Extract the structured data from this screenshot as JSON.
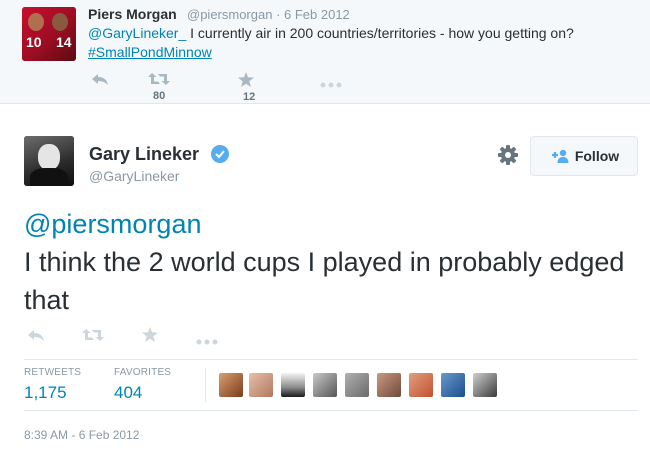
{
  "parent_tweet": {
    "author_name": "Piers Morgan",
    "meta": "@piersmorgan · 6 Feb 2012",
    "mention": "@GaryLineker_",
    "text": " I currently air in 200 countries/territories - how you getting on?",
    "hashtag": "#SmallPondMinnow",
    "avatar_numbers": [
      "10",
      "14"
    ],
    "retweet_count": "80",
    "favorite_count": "12"
  },
  "main_tweet": {
    "author_name": "Gary Lineker",
    "handle": "@GaryLineker",
    "follow_label": "Follow",
    "mention": "@piersmorgan",
    "text": "I think the 2 world cups I played in probably edged that",
    "stats": {
      "retweets_label": "RETWEETS",
      "retweets_value": "1,175",
      "favorites_label": "FAVORITES",
      "favorites_value": "404"
    },
    "timestamp": "8:39 AM - 6 Feb 2012"
  },
  "colors": {
    "link": "#0084b4",
    "verified": "#55acee",
    "muted": "#8899a6",
    "parent_bg": "#f5f8fa"
  },
  "icons": [
    "reply-icon",
    "retweet-icon",
    "favorite-icon",
    "more-icon",
    "gear-icon",
    "follow-person-icon",
    "verified-badge-icon"
  ]
}
